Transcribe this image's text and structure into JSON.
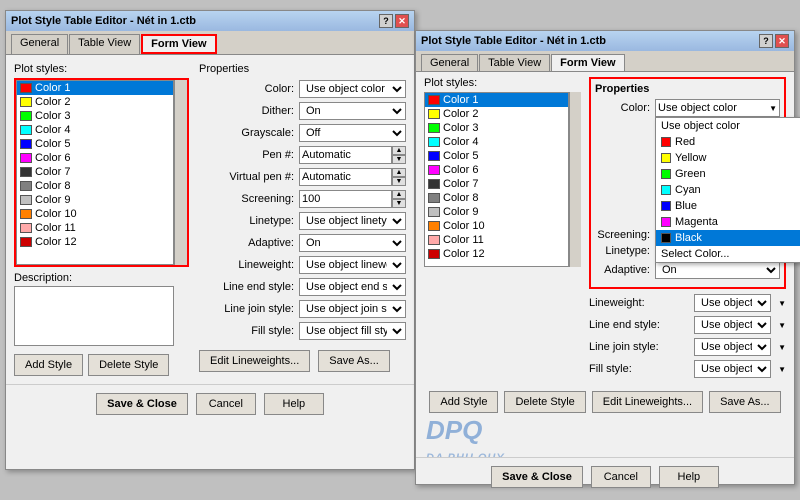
{
  "window1": {
    "title": "Plot Style Table Editor - Nét in  1.ctb",
    "tabs": [
      "General",
      "Table View",
      "Form View"
    ],
    "active_tab": "Form View",
    "plot_styles_label": "Plot styles:",
    "colors": [
      {
        "name": "Color 1",
        "swatch": "#ff0000",
        "selected": true
      },
      {
        "name": "Color 2",
        "swatch": "#ffff00"
      },
      {
        "name": "Color 3",
        "swatch": "#00ff00"
      },
      {
        "name": "Color 4",
        "swatch": "#00ffff"
      },
      {
        "name": "Color 5",
        "swatch": "#0000ff"
      },
      {
        "name": "Color 6",
        "swatch": "#ff00ff"
      },
      {
        "name": "Color 7",
        "swatch": "#000000"
      },
      {
        "name": "Color 8",
        "swatch": "#808080"
      },
      {
        "name": "Color 9",
        "swatch": "#c0c0c0"
      },
      {
        "name": "Color 10",
        "swatch": "#ff8000"
      },
      {
        "name": "Color 11",
        "swatch": "#ffaaaa"
      },
      {
        "name": "Color 12",
        "swatch": "#cc0000"
      }
    ],
    "properties": {
      "title": "Properties",
      "color_label": "Color:",
      "color_value": "Use object color",
      "dither_label": "Dither:",
      "dither_value": "On",
      "grayscale_label": "Grayscale:",
      "grayscale_value": "Off",
      "pen_label": "Pen #:",
      "pen_value": "Automatic",
      "virtualpen_label": "Virtual pen #:",
      "virtualpen_value": "Automatic",
      "screening_label": "Screening:",
      "screening_value": "100",
      "linetype_label": "Linetype:",
      "linetype_value": "Use object linetype",
      "adaptive_label": "Adaptive:",
      "adaptive_value": "On",
      "lineweight_label": "Lineweight:",
      "lineweight_value": "Use object lineweight",
      "lineend_label": "Line end style:",
      "lineend_value": "Use object end style",
      "linejoin_label": "Line join style:",
      "linejoin_value": "Use object join style",
      "fillstyle_label": "Fill style:",
      "fillstyle_value": "Use object fill style"
    },
    "description_label": "Description:",
    "buttons": {
      "add_style": "Add Style",
      "delete_style": "Delete Style",
      "edit_lineweights": "Edit Lineweights...",
      "save_as": "Save As..."
    },
    "bottom_buttons": {
      "save_close": "Save & Close",
      "cancel": "Cancel",
      "help": "Help"
    }
  },
  "window2": {
    "title": "Plot Style Table Editor - Nét in  1.ctb",
    "tabs": [
      "General",
      "Table View",
      "Form View"
    ],
    "active_tab": "Form View",
    "plot_styles_label": "Plot styles:",
    "colors": [
      {
        "name": "Color 1",
        "swatch": "#ff0000"
      },
      {
        "name": "Color 2",
        "swatch": "#ffff00"
      },
      {
        "name": "Color 3",
        "swatch": "#00ff00"
      },
      {
        "name": "Color 4",
        "swatch": "#00ffff"
      },
      {
        "name": "Color 5",
        "swatch": "#0000ff"
      },
      {
        "name": "Color 6",
        "swatch": "#ff00ff"
      },
      {
        "name": "Color 7",
        "swatch": "#000000"
      },
      {
        "name": "Color 8",
        "swatch": "#808080"
      },
      {
        "name": "Color 9",
        "swatch": "#c0c0c0"
      },
      {
        "name": "Color 10",
        "swatch": "#ff8000"
      },
      {
        "name": "Color 11",
        "swatch": "#ffaaaa"
      },
      {
        "name": "Color 12",
        "swatch": "#cc0000"
      }
    ],
    "properties": {
      "title": "Properties",
      "color_label": "Color:",
      "color_selected": "Use object color",
      "dropdown_options": [
        {
          "label": "Use object color",
          "swatch": null
        },
        {
          "label": "Red",
          "swatch": "#ff0000"
        },
        {
          "label": "Yellow",
          "swatch": "#ffff00"
        },
        {
          "label": "Green",
          "swatch": "#00ff00"
        },
        {
          "label": "Cyan",
          "swatch": "#00ffff"
        },
        {
          "label": "Blue",
          "swatch": "#0000ff"
        },
        {
          "label": "Magenta",
          "swatch": "#ff00ff"
        },
        {
          "label": "Black",
          "swatch": "#000000",
          "selected": true
        },
        {
          "label": "Select Color...",
          "swatch": null
        }
      ],
      "screening_label": "Screening:",
      "linetype_label": "Linetype:",
      "adaptive_label": "Adaptive:",
      "adaptive_value": "On",
      "lineweight_label": "Lineweight:",
      "lineweight_value": "Use object lineweight",
      "lineend_label": "Line end style:",
      "lineend_value": "Use object end style",
      "linejoin_label": "Line join style:",
      "linejoin_value": "Use object join style",
      "fillstyle_label": "Fill style:",
      "fillstyle_value": "Use object fill style"
    },
    "buttons": {
      "add_style": "Add Style",
      "delete_style": "Delete Style",
      "edit_lineweights": "Edit Lineweights...",
      "save_as": "Save As..."
    },
    "bottom_buttons": {
      "save_close": "Save & Close",
      "cancel": "Cancel",
      "help": "Help"
    },
    "watermark": "DPQ\nDA PHU QUY"
  }
}
